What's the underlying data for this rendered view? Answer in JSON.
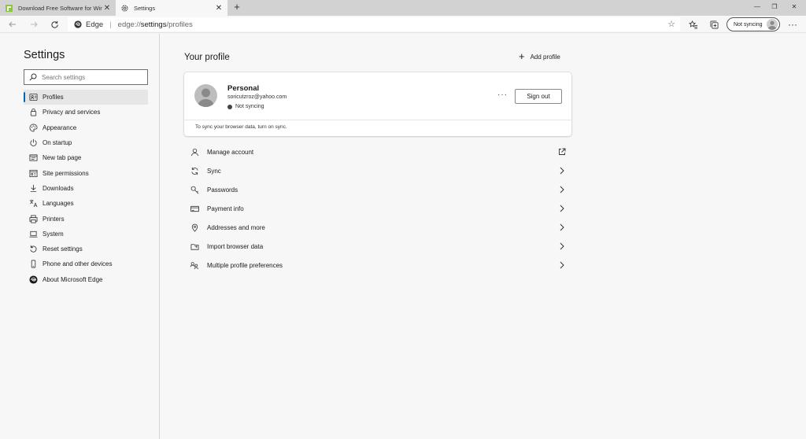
{
  "tabs": [
    {
      "title": "Download Free Software for Wir",
      "icon": "softpedia-favicon-icon"
    },
    {
      "title": "Settings",
      "icon": "gear-icon"
    }
  ],
  "toolbar": {
    "edge_label": "Edge",
    "url_scheme": "edge://",
    "url_host": "settings",
    "url_path": "/profiles",
    "sync_label": "Not syncing"
  },
  "sidebar": {
    "title": "Settings",
    "search_placeholder": "Search settings",
    "items": [
      {
        "label": "Profiles",
        "icon": "profile-icon",
        "active": true
      },
      {
        "label": "Privacy and services",
        "icon": "lock-icon"
      },
      {
        "label": "Appearance",
        "icon": "palette-icon"
      },
      {
        "label": "On startup",
        "icon": "power-icon"
      },
      {
        "label": "New tab page",
        "icon": "new-tab-icon"
      },
      {
        "label": "Site permissions",
        "icon": "site-permissions-icon"
      },
      {
        "label": "Downloads",
        "icon": "download-icon"
      },
      {
        "label": "Languages",
        "icon": "language-icon"
      },
      {
        "label": "Printers",
        "icon": "printer-icon"
      },
      {
        "label": "System",
        "icon": "laptop-icon"
      },
      {
        "label": "Reset settings",
        "icon": "reset-icon"
      },
      {
        "label": "Phone and other devices",
        "icon": "phone-icon"
      },
      {
        "label": "About Microsoft Edge",
        "icon": "edge-logo-icon"
      }
    ]
  },
  "main": {
    "title": "Your profile",
    "add_profile_label": "Add profile",
    "profile": {
      "name": "Personal",
      "email": "soricutzroz@yahoo.com",
      "status": "Not syncing",
      "more_label": "···",
      "sign_out_label": "Sign out",
      "sync_hint": "To sync your browser data, turn on sync."
    },
    "menu": [
      {
        "label": "Manage account",
        "icon": "person-icon",
        "trailing": "external-link-icon"
      },
      {
        "label": "Sync",
        "icon": "sync-icon",
        "trailing": "chevron-right-icon"
      },
      {
        "label": "Passwords",
        "icon": "key-icon",
        "trailing": "chevron-right-icon"
      },
      {
        "label": "Payment info",
        "icon": "credit-card-icon",
        "trailing": "chevron-right-icon"
      },
      {
        "label": "Addresses and more",
        "icon": "location-pin-icon",
        "trailing": "chevron-right-icon"
      },
      {
        "label": "Import browser data",
        "icon": "import-icon",
        "trailing": "chevron-right-icon"
      },
      {
        "label": "Multiple profile preferences",
        "icon": "multi-profile-icon",
        "trailing": "chevron-right-icon"
      }
    ]
  },
  "colors": {
    "accent": "#0067b8",
    "page_bg": "#f7f7f7",
    "tabstrip_bg": "#d2d2d2"
  }
}
